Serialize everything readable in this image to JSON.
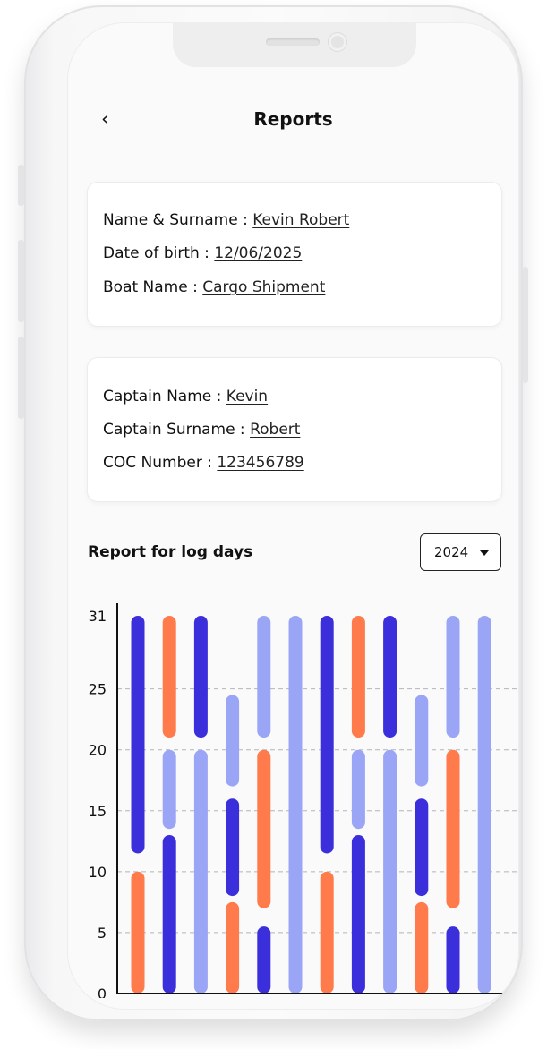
{
  "header": {
    "title": "Reports",
    "back_glyph": "‹"
  },
  "card1": {
    "rows": [
      {
        "label": "Name & Surname : ",
        "value": "Kevin Robert"
      },
      {
        "label": "Date of birth : ",
        "value": "12/06/2025"
      },
      {
        "label": "Boat Name : ",
        "value": "Cargo Shipment"
      }
    ]
  },
  "card2": {
    "rows": [
      {
        "label": "Captain Name : ",
        "value": "Kevin"
      },
      {
        "label": "Captain Surname : ",
        "value": "Robert"
      },
      {
        "label": "COC Number : ",
        "value": "123456789"
      }
    ]
  },
  "report": {
    "title": "Report for log days",
    "year": "2024"
  },
  "colors": {
    "dark": "#3b2fdc",
    "orange": "#ff7b4c",
    "light": "#9aa6f5"
  },
  "chart_data": {
    "type": "bar",
    "y_ticks": [
      0,
      5,
      10,
      15,
      20,
      25,
      31
    ],
    "ylim": [
      0,
      31
    ],
    "grid": "dashed horizontal",
    "columns": [
      [
        {
          "from": 0,
          "to": 10,
          "color": "orange"
        },
        {
          "from": 11.5,
          "to": 31,
          "color": "dark"
        }
      ],
      [
        {
          "from": 0,
          "to": 13,
          "color": "dark"
        },
        {
          "from": 13.5,
          "to": 20,
          "color": "light"
        },
        {
          "from": 21,
          "to": 31,
          "color": "orange"
        }
      ],
      [
        {
          "from": 0,
          "to": 20,
          "color": "light"
        },
        {
          "from": 21,
          "to": 31,
          "color": "dark"
        }
      ],
      [
        {
          "from": 0,
          "to": 7.5,
          "color": "orange"
        },
        {
          "from": 8,
          "to": 16,
          "color": "dark"
        },
        {
          "from": 17,
          "to": 24.5,
          "color": "light"
        }
      ],
      [
        {
          "from": 0,
          "to": 5.5,
          "color": "dark"
        },
        {
          "from": 7,
          "to": 20,
          "color": "orange"
        },
        {
          "from": 21,
          "to": 31,
          "color": "light"
        }
      ],
      [
        {
          "from": 0,
          "to": 31,
          "color": "light"
        }
      ],
      [
        {
          "from": 0,
          "to": 10,
          "color": "orange"
        },
        {
          "from": 11.5,
          "to": 31,
          "color": "dark"
        }
      ],
      [
        {
          "from": 0,
          "to": 13,
          "color": "dark"
        },
        {
          "from": 13.5,
          "to": 20,
          "color": "light"
        },
        {
          "from": 21,
          "to": 31,
          "color": "orange"
        }
      ],
      [
        {
          "from": 0,
          "to": 20,
          "color": "light"
        },
        {
          "from": 21,
          "to": 31,
          "color": "dark"
        }
      ],
      [
        {
          "from": 0,
          "to": 7.5,
          "color": "orange"
        },
        {
          "from": 8,
          "to": 16,
          "color": "dark"
        },
        {
          "from": 17,
          "to": 24.5,
          "color": "light"
        }
      ],
      [
        {
          "from": 0,
          "to": 5.5,
          "color": "dark"
        },
        {
          "from": 7,
          "to": 20,
          "color": "orange"
        },
        {
          "from": 21,
          "to": 31,
          "color": "light"
        }
      ],
      [
        {
          "from": 0,
          "to": 31,
          "color": "light"
        }
      ]
    ]
  }
}
